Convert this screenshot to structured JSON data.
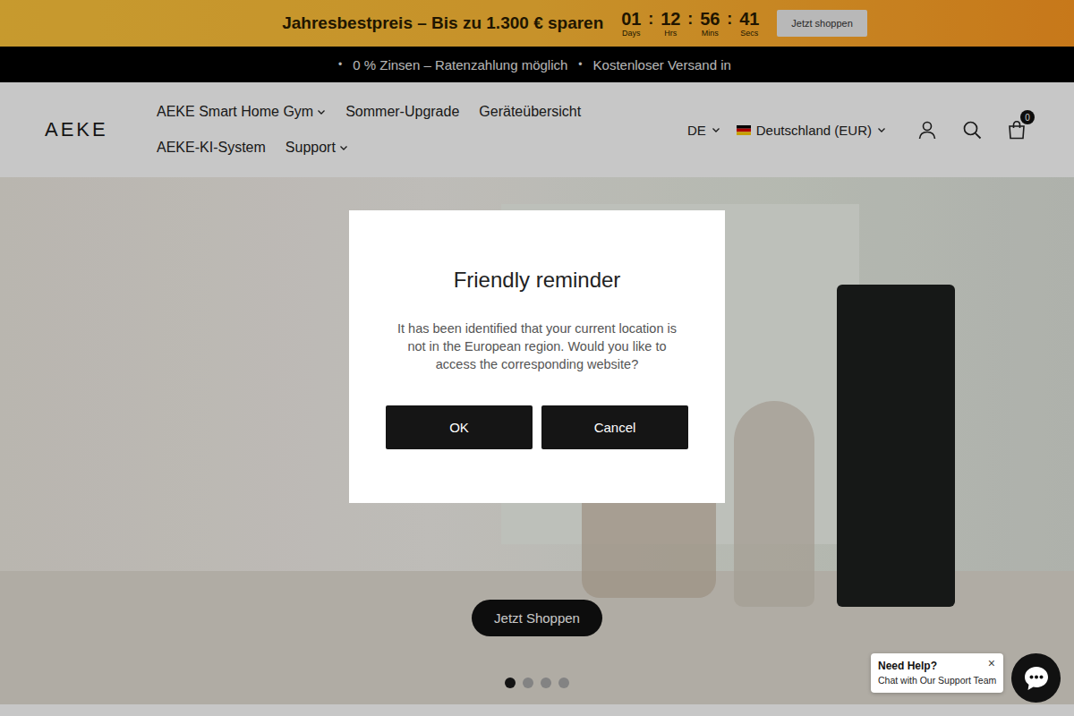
{
  "promo_bar": {
    "headline": "Jahresbestpreis – Bis zu 1.300 € sparen",
    "countdown": [
      {
        "value": "01",
        "unit": "Days"
      },
      {
        "value": "12",
        "unit": "Hrs"
      },
      {
        "value": "56",
        "unit": "Mins"
      },
      {
        "value": "41",
        "unit": "Secs"
      }
    ],
    "separator": ":",
    "button": "Jetzt shoppen"
  },
  "ticker": {
    "bullet": "•",
    "items": [
      "0 % Zinsen – Ratenzahlung möglich",
      "Kostenloser Versand in"
    ]
  },
  "header": {
    "logo": "AEKE",
    "nav": [
      {
        "label": "AEKE Smart Home Gym",
        "dropdown": true
      },
      {
        "label": "Sommer-Upgrade",
        "dropdown": false
      },
      {
        "label": "Geräteübersicht",
        "dropdown": false
      },
      {
        "label": "AEKE-KI-System",
        "dropdown": false
      },
      {
        "label": "Support",
        "dropdown": true
      }
    ],
    "language": "DE",
    "region": "Deutschland (EUR)",
    "cart_count": "0"
  },
  "hero": {
    "button": "Jetzt Shoppen",
    "slides": [
      {
        "selected": true
      },
      {
        "selected": false
      },
      {
        "selected": false
      },
      {
        "selected": false
      }
    ]
  },
  "modal": {
    "title": "Friendly reminder",
    "message": "It has been identified that your current location is not in the European region. Would you like to access the corresponding website?",
    "buttons": [
      "OK",
      "Cancel"
    ]
  },
  "chat": {
    "title": "Need Help?",
    "subtitle": "Chat with Our Support Team",
    "close": "×"
  }
}
